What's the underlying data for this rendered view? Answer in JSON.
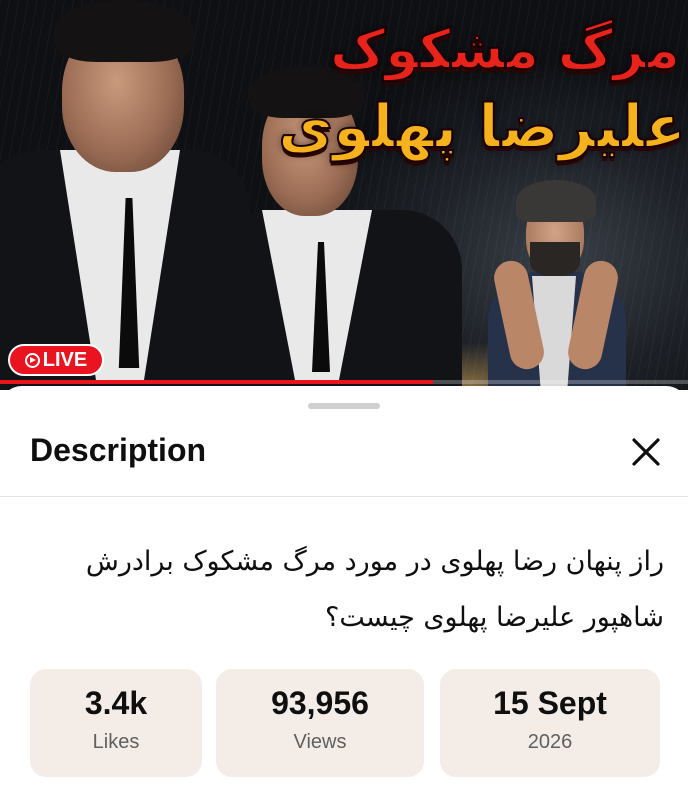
{
  "thumbnail": {
    "title_line_1": "مرگ مشکوک",
    "title_line_2": "علیرضا پهلوی",
    "live_label": "LIVE",
    "progress_fraction": 0.63,
    "colors": {
      "title_1": "#e8231b",
      "title_2": "#f5b21c",
      "live_badge": "#e9141f",
      "progress": "#e8151f"
    }
  },
  "sheet": {
    "title": "Description",
    "close_icon": "close-icon",
    "description_lines": [
      "راز پنهان رضا پهلوی در مورد مرگ مشکوک برادرش",
      "شاهپور علیرضا پهلوی چیست؟"
    ],
    "stats": [
      {
        "value": "3.4k",
        "label": "Likes"
      },
      {
        "value": "93,956",
        "label": "Views"
      },
      {
        "value": "15 Sept",
        "label": "2026"
      }
    ]
  }
}
